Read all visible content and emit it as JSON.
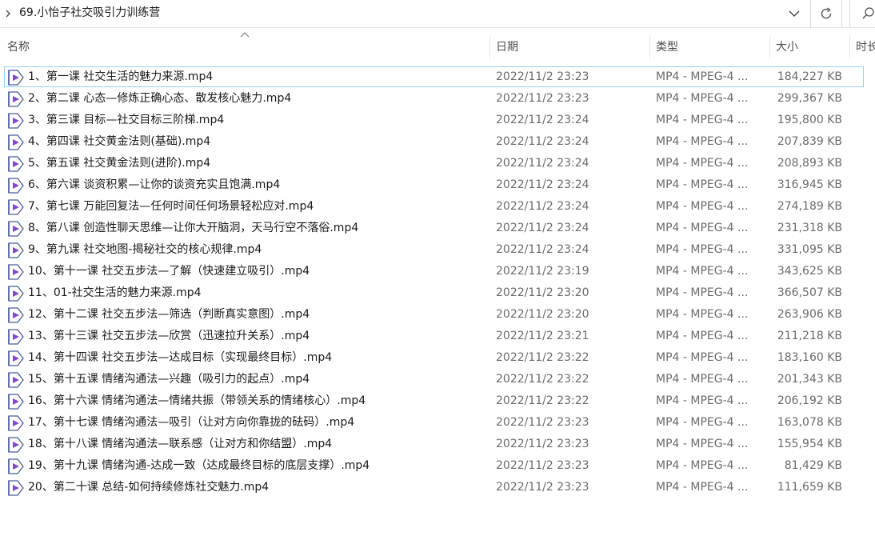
{
  "address_bar": {
    "path": "69.小怡子社交吸引力训练营"
  },
  "icons": {
    "breadcrumb": "chevron-right-icon",
    "dropdown": "chevron-down-icon",
    "refresh": "refresh-icon",
    "search": "search-icon",
    "file": "video-file-icon"
  },
  "columns": {
    "name": "名称",
    "date": "日期",
    "type": "类型",
    "size": "大小",
    "duration": "时长"
  },
  "files": [
    {
      "name": "1、第一课 社交生活的魅力来源.mp4",
      "date": "2022/11/2 23:23",
      "type": "MP4 - MPEG-4 ...",
      "size": "184,227 KB"
    },
    {
      "name": "2、第二课 心态—修炼正确心态、散发核心魅力.mp4",
      "date": "2022/11/2 23:23",
      "type": "MP4 - MPEG-4 ...",
      "size": "299,367 KB"
    },
    {
      "name": "3、第三课 目标—社交目标三阶梯.mp4",
      "date": "2022/11/2 23:24",
      "type": "MP4 - MPEG-4 ...",
      "size": "195,800 KB"
    },
    {
      "name": "4、第四课 社交黄金法则(基础).mp4",
      "date": "2022/11/2 23:24",
      "type": "MP4 - MPEG-4 ...",
      "size": "207,839 KB"
    },
    {
      "name": "5、第五课 社交黄金法则(进阶).mp4",
      "date": "2022/11/2 23:24",
      "type": "MP4 - MPEG-4 ...",
      "size": "208,893 KB"
    },
    {
      "name": "6、第六课 谈资积累—让你的谈资充实且饱满.mp4",
      "date": "2022/11/2 23:24",
      "type": "MP4 - MPEG-4 ...",
      "size": "316,945 KB"
    },
    {
      "name": "7、第七课 万能回复法—任何时间任何场景轻松应对.mp4",
      "date": "2022/11/2 23:24",
      "type": "MP4 - MPEG-4 ...",
      "size": "274,189 KB"
    },
    {
      "name": "8、第八课 创造性聊天思维—让你大开脑洞，天马行空不落俗.mp4",
      "date": "2022/11/2 23:24",
      "type": "MP4 - MPEG-4 ...",
      "size": "231,318 KB"
    },
    {
      "name": "9、第九课 社交地图-揭秘社交的核心规律.mp4",
      "date": "2022/11/2 23:24",
      "type": "MP4 - MPEG-4 ...",
      "size": "331,095 KB"
    },
    {
      "name": "10、第十一课 社交五步法—了解（快速建立吸引）.mp4",
      "date": "2022/11/2 23:19",
      "type": "MP4 - MPEG-4 ...",
      "size": "343,625 KB"
    },
    {
      "name": "11、01-社交生活的魅力来源.mp4",
      "date": "2022/11/2 23:20",
      "type": "MP4 - MPEG-4 ...",
      "size": "366,507 KB"
    },
    {
      "name": "12、第十二课 社交五步法—筛选（判断真实意图）.mp4",
      "date": "2022/11/2 23:20",
      "type": "MP4 - MPEG-4 ...",
      "size": "263,906 KB"
    },
    {
      "name": "13、第十三课 社交五步法—欣赏（迅速拉升关系）.mp4",
      "date": "2022/11/2 23:21",
      "type": "MP4 - MPEG-4 ...",
      "size": "211,218 KB"
    },
    {
      "name": "14、第十四课 社交五步法—达成目标（实现最终目标）.mp4",
      "date": "2022/11/2 23:22",
      "type": "MP4 - MPEG-4 ...",
      "size": "183,160 KB"
    },
    {
      "name": "15、第十五课 情绪沟通法—兴趣（吸引力的起点）.mp4",
      "date": "2022/11/2 23:22",
      "type": "MP4 - MPEG-4 ...",
      "size": "201,343 KB"
    },
    {
      "name": "16、第十六课 情绪沟通法—情绪共振（带领关系的情绪核心）.mp4",
      "date": "2022/11/2 23:22",
      "type": "MP4 - MPEG-4 ...",
      "size": "206,192 KB"
    },
    {
      "name": "17、第十七课 情绪沟通法—吸引（让对方向你靠拢的砝码）.mp4",
      "date": "2022/11/2 23:23",
      "type": "MP4 - MPEG-4 ...",
      "size": "163,078 KB"
    },
    {
      "name": "18、第十八课 情绪沟通法—联系感（让对方和你结盟）.mp4",
      "date": "2022/11/2 23:23",
      "type": "MP4 - MPEG-4 ...",
      "size": "155,954 KB"
    },
    {
      "name": "19、第十九课 情绪沟通-达成一致（达成最终目标的底层支撑）.mp4",
      "date": "2022/11/2 23:23",
      "type": "MP4 - MPEG-4 ...",
      "size": "81,429 KB"
    },
    {
      "name": "20、第二十课 总结-如何持续修炼社交魅力.mp4",
      "date": "2022/11/2 23:23",
      "type": "MP4 - MPEG-4 ...",
      "size": "111,659 KB"
    }
  ]
}
